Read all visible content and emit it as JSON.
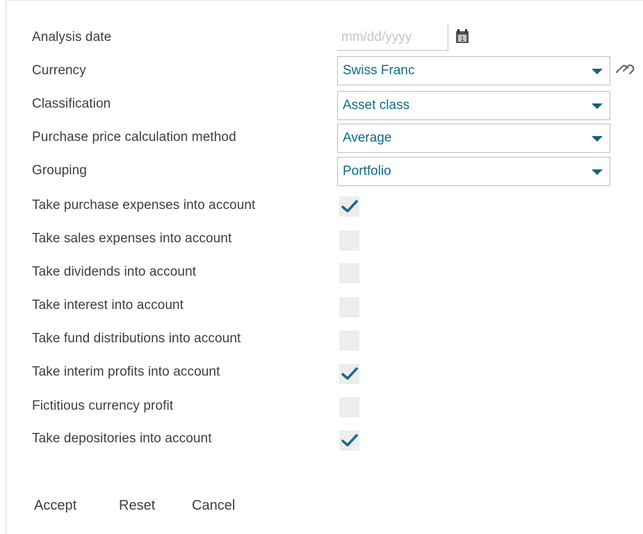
{
  "form": {
    "analysis_date": {
      "label": "Analysis date",
      "value": "",
      "placeholder": "mm/dd/yyyy"
    },
    "currency": {
      "label": "Currency",
      "selected": "Swiss Franc"
    },
    "classification": {
      "label": "Classification",
      "selected": "Asset class"
    },
    "purchase_price_method": {
      "label": "Purchase price calculation method",
      "selected": "Average"
    },
    "grouping": {
      "label": "Grouping",
      "selected": "Portfolio"
    },
    "checkboxes": [
      {
        "label": "Take purchase expenses into account",
        "checked": true
      },
      {
        "label": "Take sales expenses into account",
        "checked": false
      },
      {
        "label": "Take dividends into account",
        "checked": false
      },
      {
        "label": "Take interest into account",
        "checked": false
      },
      {
        "label": "Take fund distributions into account",
        "checked": false
      },
      {
        "label": "Take interim profits into account",
        "checked": true
      },
      {
        "label": "Fictitious currency profit",
        "checked": false
      },
      {
        "label": "Take depositories into account",
        "checked": true
      }
    ]
  },
  "footer": {
    "accept_label": "Accept",
    "reset_label": "Reset",
    "cancel_label": "Cancel"
  },
  "icons": {
    "calendar": "calendar-icon",
    "currency_link": "chain-link-icon",
    "check": "checkmark-icon",
    "dropdown": "caret-down-icon"
  },
  "colors": {
    "accent": "#0f6c83",
    "checkmark": "#1a6c85",
    "caret": "#1a5f78",
    "checkbox_bg": "#ededed",
    "label_text": "#3d3d3d"
  }
}
